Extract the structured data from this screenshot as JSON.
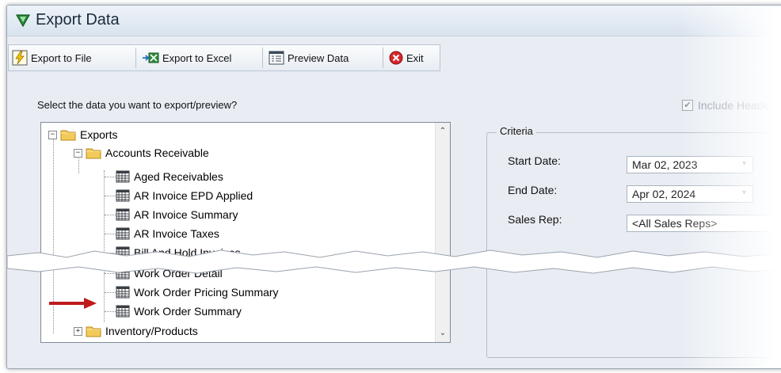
{
  "window": {
    "title": "Export Data"
  },
  "toolbar": {
    "export_file": "Export to File",
    "export_excel": "Export to Excel",
    "preview": "Preview Data",
    "exit": "Exit"
  },
  "prompt": "Select the data you want to export/preview?",
  "include_header": {
    "label": "Include Heade",
    "checked": true
  },
  "tree": {
    "root": "Exports",
    "ar_folder": "Accounts Receivable",
    "ar_items": [
      "Aged Receivables",
      "AR Invoice EPD Applied",
      "AR Invoice Summary",
      "AR Invoice Taxes",
      "Bill And Hold Invoices"
    ],
    "wo_items": [
      "Work Order Detail",
      "Work Order Pricing Summary",
      "Work Order Summary"
    ],
    "inventory_folder": "Inventory/Products"
  },
  "criteria": {
    "title": "Criteria",
    "start_label": "Start Date:",
    "start_value": "Mar 02, 2023",
    "end_label": "End Date:",
    "end_value": "Apr 02, 2024",
    "rep_label": "Sales Rep:",
    "rep_value": "<All Sales Reps>"
  },
  "colors": {
    "accent_arrow": "#c0191c",
    "window_bg": "#e9edf3"
  },
  "icons": [
    "app-triangle-icon",
    "lightning-icon",
    "excel-icon",
    "preview-icon",
    "exit-icon",
    "folder-icon",
    "report-icon"
  ]
}
